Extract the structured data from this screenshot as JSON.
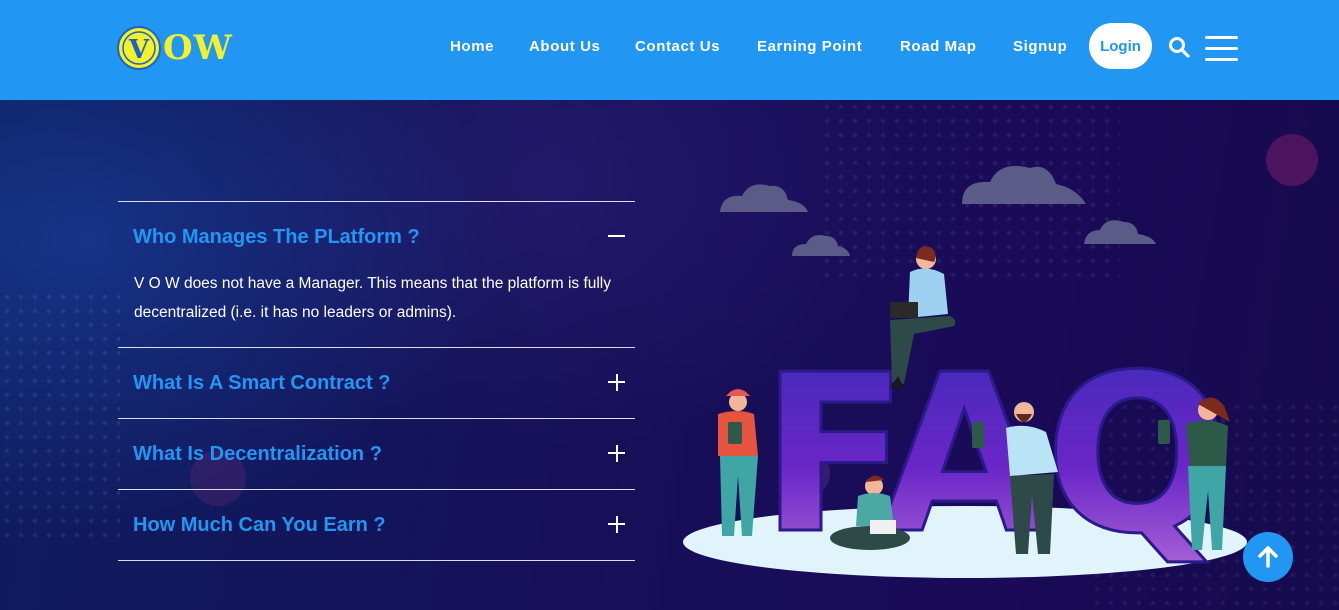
{
  "brand": {
    "logo_text": "OW",
    "logo_emblem_letter": "V"
  },
  "nav": {
    "items": [
      {
        "label": "Home"
      },
      {
        "label": "About Us"
      },
      {
        "label": "Contact Us"
      },
      {
        "label": "Earning Point"
      },
      {
        "label": "Road Map"
      },
      {
        "label": "Signup"
      }
    ],
    "login_label": "Login",
    "search_icon": "search-icon",
    "menu_icon": "hamburger-menu-icon"
  },
  "faq": {
    "items": [
      {
        "question": "Who Manages The PLatform ?",
        "expanded": true,
        "answer": "V O W does not have a Manager. This means that the platform is fully decentralized (i.e. it has no leaders or admins)."
      },
      {
        "question": "What Is A Smart Contract ?",
        "expanded": false
      },
      {
        "question": "What Is Decentralization ?",
        "expanded": false
      },
      {
        "question": "How Much Can You Earn ?",
        "expanded": false
      }
    ]
  },
  "illustration": {
    "letters": "FAQ"
  },
  "scroll_top_icon": "arrow-up-icon",
  "colors": {
    "primary": "#2196f3",
    "logo_yellow": "#f4f02a",
    "background_dark": "#13104a",
    "faq_letters": "#6a26c7"
  }
}
